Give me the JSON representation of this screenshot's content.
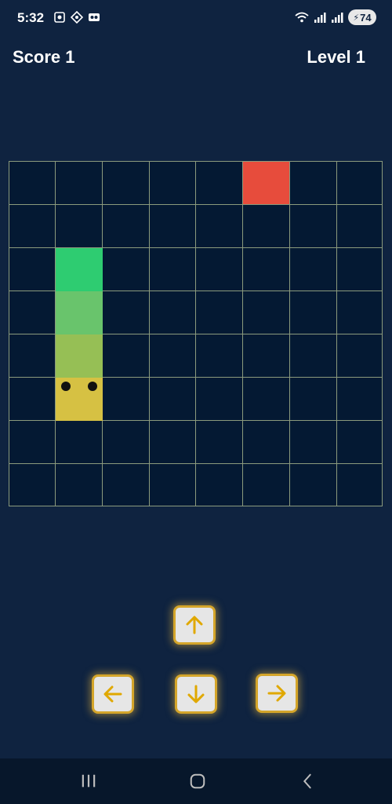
{
  "status": {
    "time": "5:32",
    "battery": "74"
  },
  "hud": {
    "score_text": "Score 1",
    "level_text": "Level 1"
  },
  "board": {
    "cols": 8,
    "rows": 8,
    "food": {
      "col": 5,
      "row": 0
    },
    "snake": [
      {
        "col": 1,
        "row": 2,
        "color": "#2ecc71"
      },
      {
        "col": 1,
        "row": 3,
        "color": "#69c46c"
      },
      {
        "col": 1,
        "row": 4,
        "color": "#96bf55"
      },
      {
        "col": 1,
        "row": 5,
        "color": "#d6c143",
        "head": true
      }
    ],
    "colors": {
      "grid_line": "#8b9a7d",
      "food": "#e74c3c",
      "background": "#041933"
    }
  },
  "controls": {
    "up": "arrow-up-icon",
    "left": "arrow-left-icon",
    "down": "arrow-down-icon",
    "right": "arrow-right-icon",
    "accent": "#d4a52a"
  },
  "nav": {
    "recent": "recent-apps-icon",
    "home": "home-icon",
    "back": "back-icon"
  }
}
